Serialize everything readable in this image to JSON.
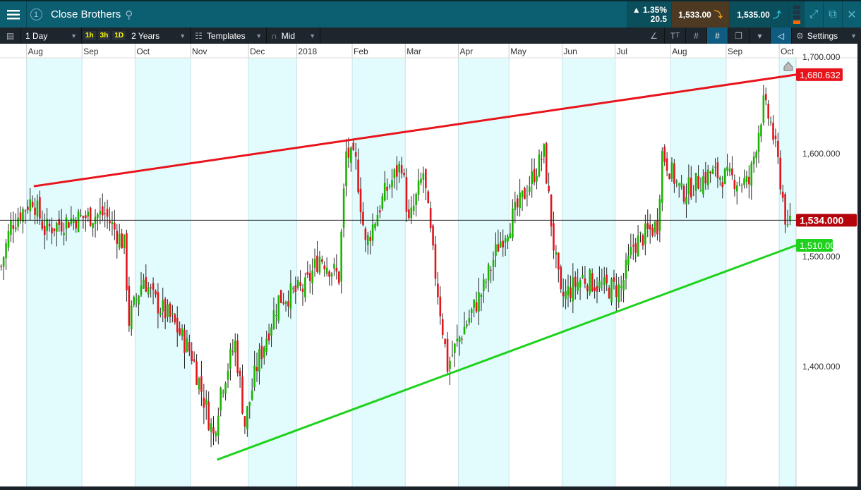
{
  "header": {
    "title": "Close Brothers",
    "window_number": "1",
    "change_pct": "1.35%",
    "change_abs": "20.5",
    "sell": "1,533.00",
    "buy": "1,535.00"
  },
  "toolbar": {
    "interval": "1 Day",
    "quick": [
      "1h",
      "3h",
      "1D"
    ],
    "range": "2 Years",
    "templates": "Templates",
    "price_type": "Mid",
    "settings": "Settings"
  },
  "colors": {
    "up": "#19b400",
    "down": "#e3141c",
    "resistance": "#e8141c",
    "support": "#1ed21e",
    "shade": "#e2fbfc"
  },
  "chart_data": {
    "type": "candlestick",
    "x_labels": [
      {
        "day": 11,
        "label": "Aug"
      },
      {
        "day": 34,
        "label": "Sep"
      },
      {
        "day": 56,
        "label": "Oct"
      },
      {
        "day": 79,
        "label": "Nov"
      },
      {
        "day": 103,
        "label": "Dec"
      },
      {
        "day": 123,
        "label": "2018"
      },
      {
        "day": 146,
        "label": "Feb"
      },
      {
        "day": 168,
        "label": "Mar"
      },
      {
        "day": 190,
        "label": "Apr"
      },
      {
        "day": 211,
        "label": "May"
      },
      {
        "day": 233,
        "label": "Jun"
      },
      {
        "day": 255,
        "label": "Jul"
      },
      {
        "day": 278,
        "label": "Aug"
      },
      {
        "day": 301,
        "label": "Sep"
      },
      {
        "day": 323,
        "label": "Oct"
      }
    ],
    "total_days": 330,
    "y_ticks": [
      {
        "v": 1700,
        "label": "1,700.000"
      },
      {
        "v": 1600,
        "label": "1,600.000"
      },
      {
        "v": 1500,
        "label": "1,500.000"
      },
      {
        "v": 1400,
        "label": "1,400.000"
      }
    ],
    "ylim": [
      1290,
      1715
    ],
    "y_scale": "log",
    "close_path": [
      [
        0,
        1490
      ],
      [
        4,
        1530
      ],
      [
        13,
        1555
      ],
      [
        18,
        1525
      ],
      [
        29,
        1535
      ],
      [
        43,
        1540
      ],
      [
        51,
        1510
      ],
      [
        53,
        1440
      ],
      [
        59,
        1480
      ],
      [
        63,
        1460
      ],
      [
        71,
        1440
      ],
      [
        79,
        1410
      ],
      [
        88,
        1340
      ],
      [
        91,
        1380
      ],
      [
        97,
        1420
      ],
      [
        101,
        1350
      ],
      [
        106,
        1400
      ],
      [
        115,
        1460
      ],
      [
        126,
        1470
      ],
      [
        132,
        1500
      ],
      [
        140,
        1480
      ],
      [
        143,
        1600
      ],
      [
        147,
        1590
      ],
      [
        151,
        1510
      ],
      [
        159,
        1560
      ],
      [
        166,
        1590
      ],
      [
        169,
        1530
      ],
      [
        175,
        1580
      ],
      [
        179,
        1500
      ],
      [
        185,
        1400
      ],
      [
        191,
        1430
      ],
      [
        200,
        1470
      ],
      [
        206,
        1510
      ],
      [
        215,
        1550
      ],
      [
        225,
        1600
      ],
      [
        229,
        1510
      ],
      [
        232,
        1460
      ],
      [
        241,
        1480
      ],
      [
        250,
        1470
      ],
      [
        257,
        1470
      ],
      [
        262,
        1510
      ],
      [
        272,
        1530
      ],
      [
        274,
        1600
      ],
      [
        282,
        1560
      ],
      [
        294,
        1580
      ],
      [
        310,
        1570
      ],
      [
        316,
        1650
      ],
      [
        319,
        1630
      ],
      [
        322,
        1590
      ],
      [
        326,
        1520
      ],
      [
        327,
        1534
      ]
    ],
    "resistance_line": {
      "from": [
        14,
        1567
      ],
      "to": [
        330,
        1680.632
      ],
      "label": "1,680.632"
    },
    "support_line": {
      "from": [
        90,
        1320
      ],
      "to": [
        330,
        1510
      ],
      "label": "1,510.000"
    },
    "current_price": {
      "value": 1534,
      "label": "1,534.000"
    }
  }
}
